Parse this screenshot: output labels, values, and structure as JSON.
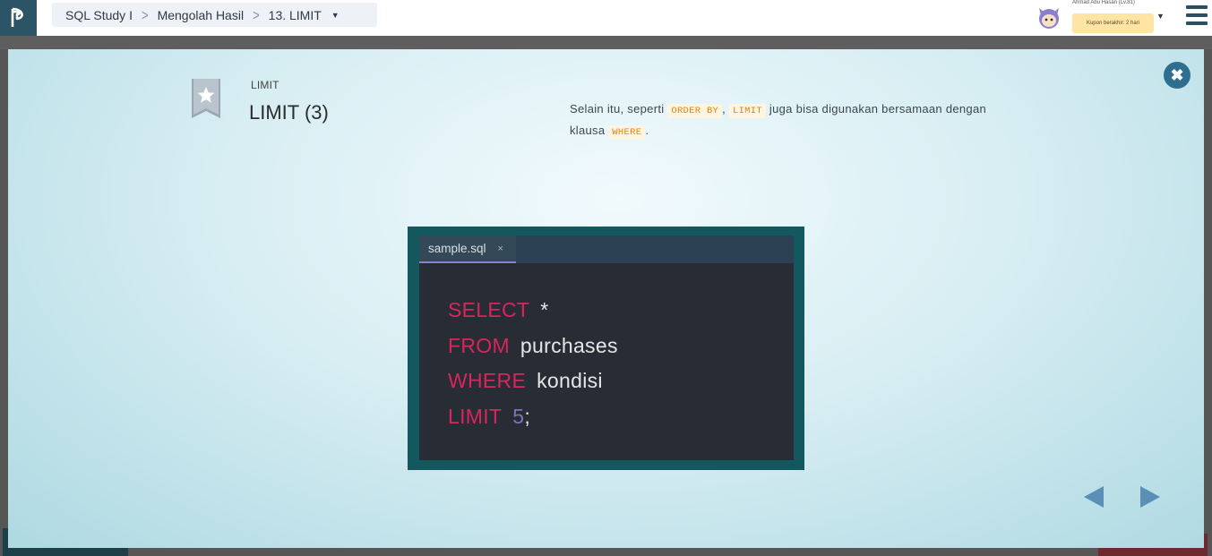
{
  "topbar": {
    "breadcrumb": [
      {
        "label": "SQL Study I"
      },
      {
        "label": "Mengolah Hasil"
      },
      {
        "label": "13. LIMIT"
      }
    ],
    "user_name": "Ahmad Abu Hasan (Lv.81)",
    "coupon": "Kupon berakhir: 2 hari",
    "logo_icon": "progate-logo-icon",
    "menu_icon": "hamburger-menu-icon"
  },
  "slide": {
    "label": "LIMIT",
    "title": "LIMIT (3)",
    "description": {
      "part1": "Selain itu, seperti ",
      "kw1": "ORDER BY",
      "part2": ", ",
      "kw2": "LIMIT",
      "part3": " juga bisa digunakan bersamaan dengan klausa ",
      "kw3": "WHERE",
      "part4": "."
    }
  },
  "editor": {
    "tab_name": "sample.sql",
    "tab_close": "×",
    "lines": [
      {
        "keyword": "SELECT",
        "rest": "*"
      },
      {
        "keyword": "FROM",
        "rest": "purchases"
      },
      {
        "keyword": "WHERE",
        "rest": "kondisi"
      },
      {
        "keyword": "LIMIT",
        "number": "5",
        "rest": ";"
      }
    ]
  },
  "colors": {
    "accent": "#2e6e8e",
    "sql_keyword": "#d7265c",
    "sql_number": "#7e72c0",
    "inline_keyword": "#d4881b",
    "nav_arrow": "#5b8fb5"
  }
}
